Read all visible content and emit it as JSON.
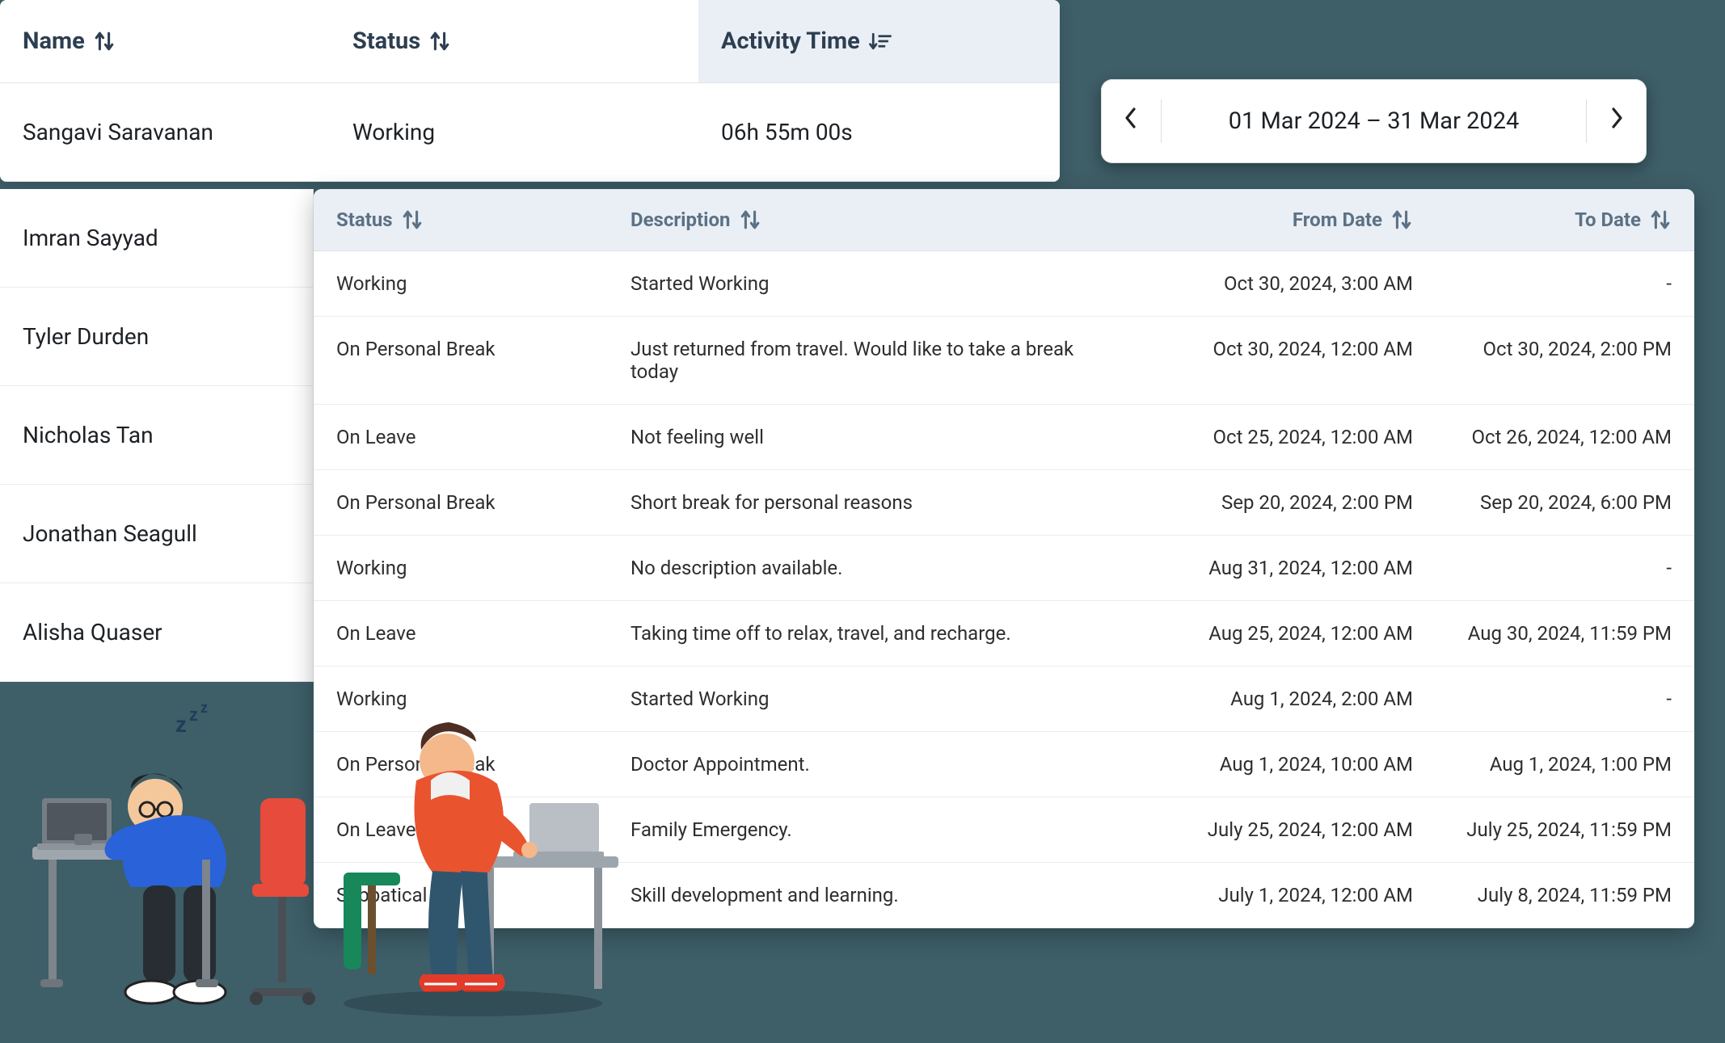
{
  "overview": {
    "headers": {
      "name": "Name",
      "status": "Status",
      "activity": "Activity Time"
    },
    "row": {
      "name": "Sangavi Saravanan",
      "status": "Working",
      "activity": "06h 55m 00s"
    }
  },
  "side_names": [
    "Imran Sayyad",
    "Tyler Durden",
    "Nicholas Tan",
    "Jonathan Seagull",
    "Alisha Quaser"
  ],
  "daterange": {
    "text": "01 Mar 2024 – 31 Mar 2024"
  },
  "detail": {
    "headers": {
      "status": "Status",
      "desc": "Description",
      "from": "From Date",
      "to": "To Date"
    },
    "rows": [
      {
        "status": "Working",
        "desc": "Started Working",
        "from": "Oct 30, 2024, 3:00 AM",
        "to": "-"
      },
      {
        "status": "On Personal Break",
        "desc": "Just returned from travel. Would like to take a break today",
        "from": "Oct 30, 2024, 12:00 AM",
        "to": "Oct 30, 2024, 2:00 PM"
      },
      {
        "status": "On Leave",
        "desc": "Not feeling well",
        "from": "Oct 25, 2024, 12:00 AM",
        "to": "Oct 26, 2024, 12:00 AM"
      },
      {
        "status": "On Personal Break",
        "desc": "Short break for personal reasons",
        "from": "Sep 20, 2024, 2:00 PM",
        "to": "Sep 20, 2024, 6:00 PM"
      },
      {
        "status": "Working",
        "desc": "No description available.",
        "from": "Aug 31, 2024, 12:00 AM",
        "to": "-"
      },
      {
        "status": "On Leave",
        "desc": "Taking time off to relax, travel, and recharge.",
        "from": "Aug 25, 2024, 12:00 AM",
        "to": "Aug 30, 2024, 11:59 PM"
      },
      {
        "status": "Working",
        "desc": "Started Working",
        "from": "Aug 1, 2024, 2:00 AM",
        "to": "-"
      },
      {
        "status": "On Personal Break",
        "desc": "Doctor Appointment.",
        "from": "Aug 1, 2024, 10:00 AM",
        "to": "Aug 1, 2024, 1:00 PM"
      },
      {
        "status": "On Leave",
        "desc": "Family Emergency.",
        "from": "July 25, 2024, 12:00 AM",
        "to": "July 25, 2024, 11:59 PM"
      },
      {
        "status": "Sabbatical",
        "desc": "Skill development and learning.",
        "from": "July 1, 2024, 12:00 AM",
        "to": "July 8, 2024, 11:59 PM"
      }
    ]
  }
}
